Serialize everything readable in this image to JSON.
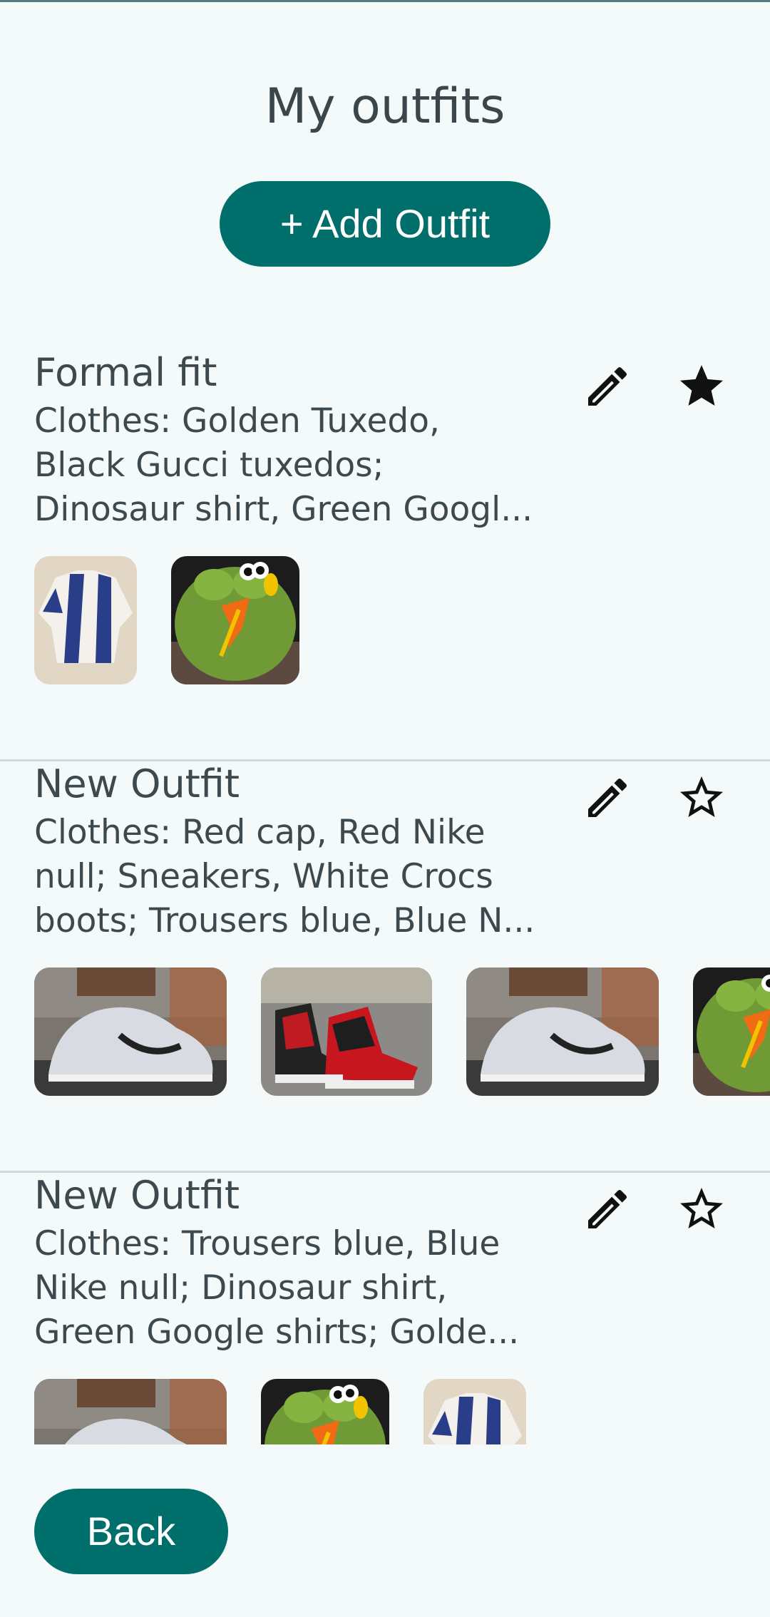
{
  "header": {
    "title": "My outfits"
  },
  "actions": {
    "add_label": "+ Add Outfit",
    "back_label": "Back"
  },
  "colors": {
    "primary": "#006e6b",
    "background": "#f4f9f9",
    "text": "#3c4a4f",
    "divider": "#cfdad9"
  },
  "outfits": [
    {
      "name": "Formal fit",
      "clothes": "Clothes: Golden Tuxedo, Black Gucci tuxedos; Dinosaur shirt, Green Googl...",
      "favorite": true,
      "edit_icon": "pencil-icon",
      "favorite_icon": "star-filled-icon",
      "images": [
        "striped-shirt",
        "green-frog-plush"
      ]
    },
    {
      "name": "New Outfit",
      "clothes": "Clothes: Red cap, Red Nike null; Sneakers, White Crocs boots; Trousers blue, Blue N...",
      "favorite": false,
      "edit_icon": "pencil-icon",
      "favorite_icon": "star-outline-icon",
      "images": [
        "grey-sneaker",
        "red-black-sneakers",
        "grey-sneaker",
        "green-frog-plush"
      ]
    },
    {
      "name": "New Outfit",
      "clothes": "Clothes: Trousers blue, Blue Nike null; Dinosaur shirt, Green Google shirts; Golde...",
      "favorite": false,
      "edit_icon": "pencil-icon",
      "favorite_icon": "star-outline-icon",
      "images": [
        "grey-sneaker",
        "green-frog-plush",
        "striped-shirt"
      ]
    }
  ]
}
